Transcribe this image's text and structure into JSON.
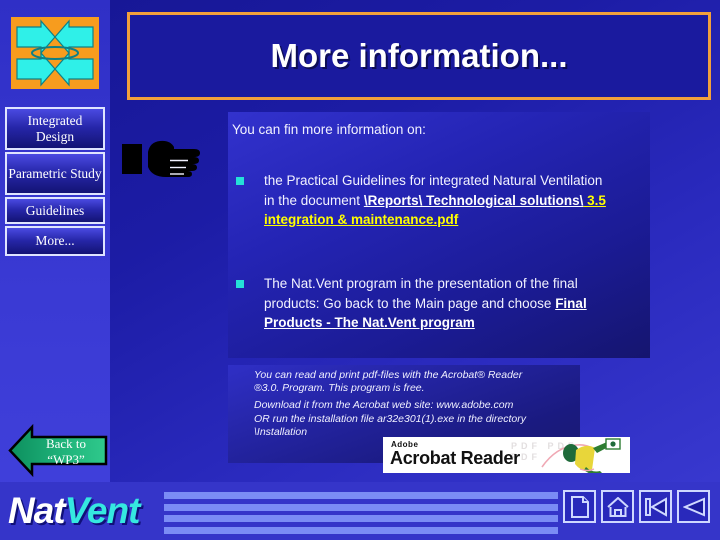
{
  "slide": {
    "title": "More information...",
    "logo_icon": "four-arrows-inward-icon",
    "pointer_icon": "pointing-hand-icon"
  },
  "sidebar": {
    "items": [
      {
        "label": "Integrated Design",
        "name": "sidebar-item-integrated-design"
      },
      {
        "label": "Parametric Study",
        "name": "sidebar-item-parametric-study"
      },
      {
        "label": "Guidelines",
        "name": "sidebar-item-guidelines"
      },
      {
        "label": "More...",
        "name": "sidebar-item-more"
      }
    ]
  },
  "content": {
    "intro": "You can fin more information on:",
    "bullets": [
      {
        "plain_lead": "the Practical Guidelines  for integrated Natural Ventilation in the document ",
        "highlight_white": "\\Reports\\ Technological solutions\\",
        "highlight_yellow": " 3.5  integration & maintenance.pdf",
        "bullet_marker": "cyan-square-bullet"
      },
      {
        "plain_lead": "The Nat.Vent program in the presentation of the final products: Go back to the Main page and choose ",
        "highlight_white": "Final Products - The Nat.Vent program",
        "highlight_yellow": "",
        "bullet_marker": "cyan-square-bullet"
      }
    ]
  },
  "note": {
    "line1": "You can read and print pdf-files with the Acrobat® Reader",
    "line2": "®3.0. Program. This program is free.",
    "line3": "Download it from the Acrobat web site: www.adobe.com",
    "line4": "OR run the installation file ar32e301(1).exe in the directory",
    "line5": "\\Installation"
  },
  "acrobat": {
    "brand": "Adobe",
    "product": "Acrobat Reader",
    "watermark": "PDF PDF PDF",
    "figure_icon": "acrobat-runner-icon"
  },
  "footer": {
    "back_line1": "Back  to",
    "back_line2": "“WP3”",
    "wordmark_part1": "Nat",
    "wordmark_part2": "Vent",
    "nav_icons": [
      {
        "name": "document-icon",
        "label": "document"
      },
      {
        "name": "home-icon",
        "label": "home"
      },
      {
        "name": "first-slide-icon",
        "label": "first"
      },
      {
        "name": "previous-slide-icon",
        "label": "previous"
      }
    ]
  },
  "colors": {
    "accent_orange": "#f2a03c",
    "logo_orange": "#f79c1e",
    "arrow_cyan": "#2ff0e8",
    "bullet_cyan": "#25e0d8",
    "highlight_yellow": "#ffff00",
    "back_green": "#16a86e",
    "stripe_blue": "#7b8cf5",
    "bg_blue": "#2b2bc4"
  }
}
